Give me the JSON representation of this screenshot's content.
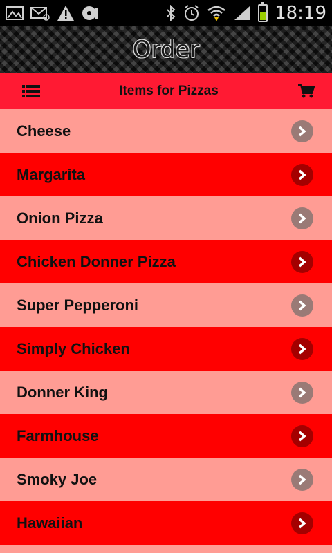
{
  "status_bar": {
    "time": "18:19",
    "icons": [
      "gallery-icon",
      "mail-icon",
      "warning-icon",
      "disc-icon",
      "bluetooth-icon",
      "alarm-icon",
      "wifi-icon",
      "signal-icon",
      "battery-icon"
    ]
  },
  "header": {
    "title": "Order"
  },
  "toolbar": {
    "title": "Items for Pizzas",
    "menu_icon": "list-icon",
    "cart_icon": "cart-icon"
  },
  "items": [
    {
      "label": "Cheese"
    },
    {
      "label": "Margarita"
    },
    {
      "label": "Onion Pizza"
    },
    {
      "label": "Chicken Donner Pizza"
    },
    {
      "label": "Super Pepperoni"
    },
    {
      "label": "Simply Chicken"
    },
    {
      "label": "Donner King"
    },
    {
      "label": "Farmhouse"
    },
    {
      "label": "Smoky Joe"
    },
    {
      "label": "Hawaiian"
    }
  ],
  "colors": {
    "row_light": "#ff9c94",
    "row_dark": "#ff0000",
    "toolbar": "#ff1a33"
  }
}
